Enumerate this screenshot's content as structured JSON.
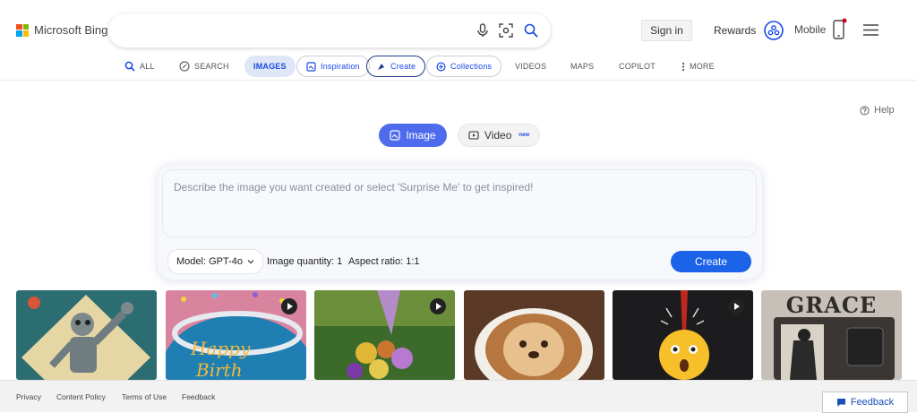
{
  "brand": {
    "name": "Microsoft Bing",
    "colors": [
      "#f25022",
      "#7fba00",
      "#00a4ef",
      "#ffb900"
    ]
  },
  "search": {
    "value": "",
    "icons": [
      "microphone-icon",
      "visual-search-icon",
      "search-icon"
    ]
  },
  "header": {
    "signin": "Sign in",
    "rewards": "Rewards",
    "mobile": "Mobile"
  },
  "nav": {
    "items": [
      {
        "label": "ALL",
        "icon": "search-icon"
      },
      {
        "label": "SEARCH",
        "icon": "copilot-search-icon"
      },
      {
        "label": "IMAGES",
        "icon": ""
      },
      {
        "label": "Inspiration",
        "icon": "inspiration-icon"
      },
      {
        "label": "Create",
        "icon": "create-icon"
      },
      {
        "label": "Collections",
        "icon": "collections-icon"
      },
      {
        "label": "VIDEOS",
        "icon": ""
      },
      {
        "label": "MAPS",
        "icon": ""
      },
      {
        "label": "COPILOT",
        "icon": ""
      },
      {
        "label": "MORE",
        "icon": "more-vertical-icon"
      }
    ]
  },
  "help": "Help",
  "modes": {
    "image": "Image",
    "video": "Video",
    "video_badge": "new"
  },
  "creator": {
    "placeholder": "Describe the image you want created or select 'Surprise Me' to get inspired!",
    "model": "Model: GPT-4o",
    "quantity": "Image quantity: 1",
    "aspect": "Aspect ratio: 1:1",
    "create": "Create"
  },
  "gallery": [
    {
      "title": "GRACE"
    }
  ],
  "footer": {
    "links": [
      "Privacy",
      "Content Policy",
      "Terms of Use",
      "Feedback"
    ],
    "feedback_button": "Feedback"
  },
  "accent": "#174ae4"
}
